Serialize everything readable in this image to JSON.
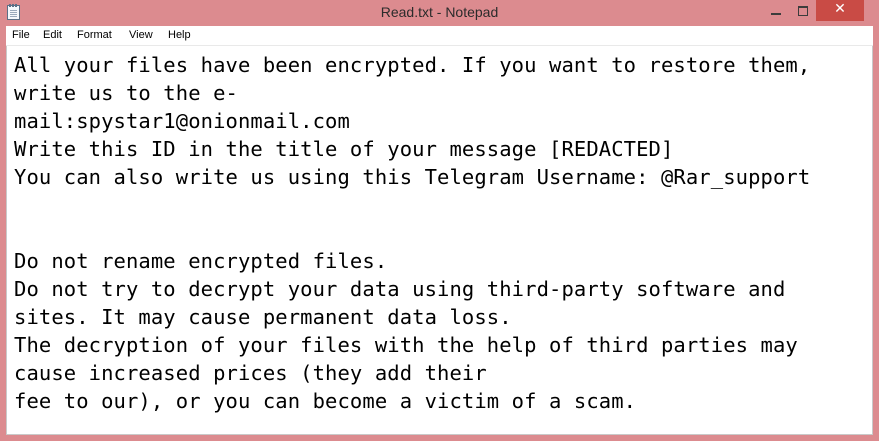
{
  "window": {
    "title": "Read.txt - Notepad",
    "close_glyph": "✕",
    "accent_color": "#dc8b8f",
    "close_color": "#c94b45",
    "icons": [
      "notepad-app-icon",
      "minimize-icon",
      "maximize-icon",
      "close-icon"
    ]
  },
  "menu": {
    "file": "File",
    "edit": "Edit",
    "format": "Format",
    "view": "View",
    "help": "Help"
  },
  "document": {
    "lines": [
      "All your files have been encrypted. If you want to restore them,",
      "write us to the e-",
      "mail:spystar1@onionmail.com",
      "Write this ID in the title of your message [REDACTED]",
      "You can also write us using this Telegram Username: @Rar_support",
      "",
      "",
      "Do not rename encrypted files.",
      "Do not try to decrypt your data using third-party software and",
      "sites. It may cause permanent data loss.",
      "The decryption of your files with the help of third parties may",
      "cause increased prices (they add their",
      "fee to our), or you can become a victim of a scam."
    ]
  }
}
